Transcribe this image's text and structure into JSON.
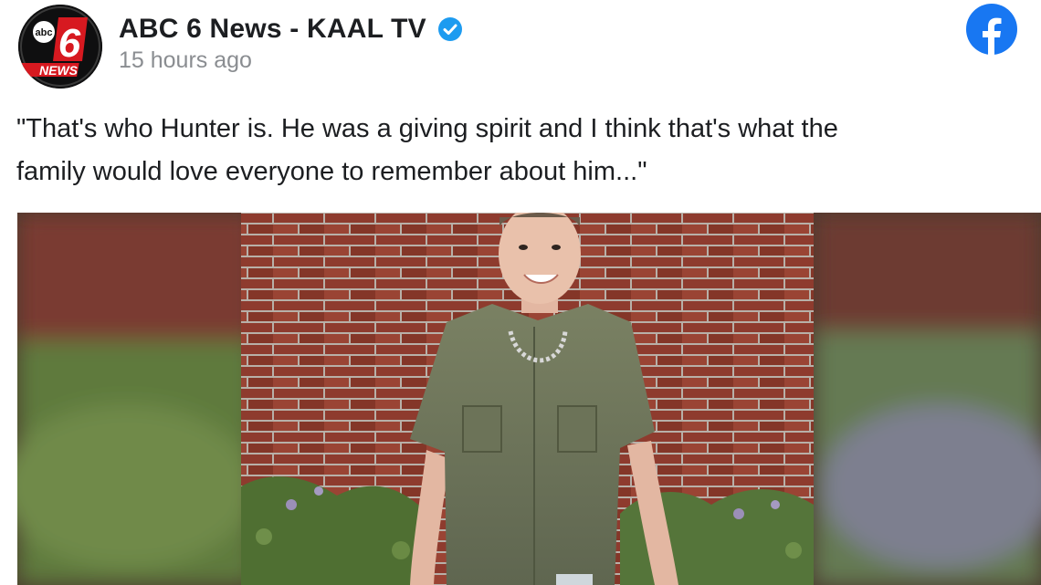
{
  "post": {
    "page_name": "ABC 6 News - KAAL TV",
    "timestamp": "15 hours ago",
    "caption_line1": "\"That's who Hunter is. He was a giving spirit and I think that's what the",
    "caption_line2": "family would love everyone to remember about him...\"",
    "avatar": {
      "logo_text_top": "abc",
      "logo_number": "6",
      "logo_text_bottom": "NEWS"
    },
    "icons": {
      "verified": "verified-badge-icon",
      "facebook": "facebook-logo-icon"
    },
    "colors": {
      "facebook_blue": "#1877f2",
      "verified_blue": "#1d9bf0",
      "logo_red": "#d71920"
    }
  }
}
